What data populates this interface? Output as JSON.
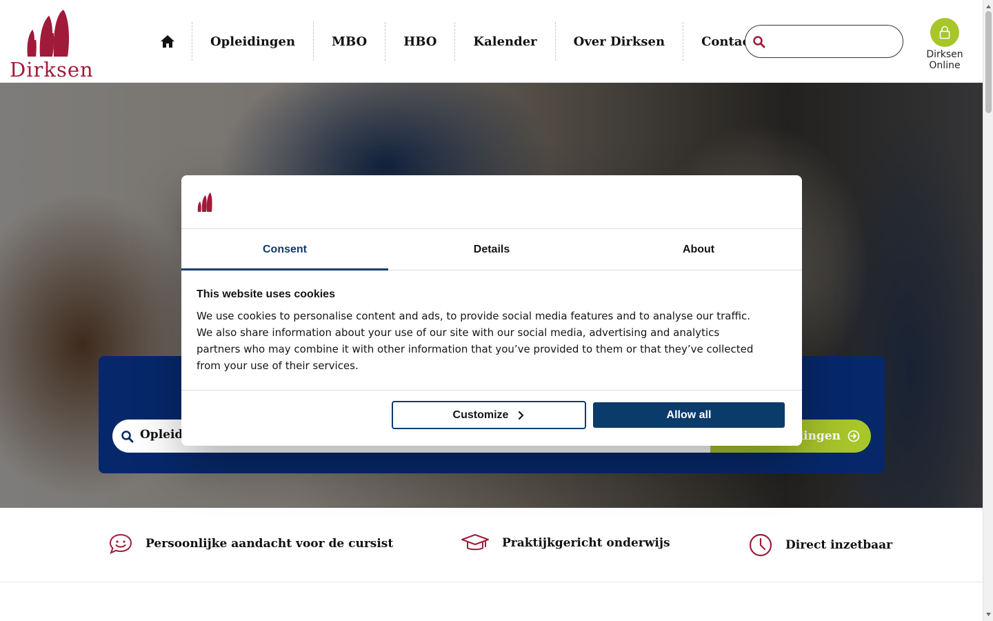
{
  "header": {
    "logo_text": "Dirksen",
    "nav": [
      "Opleidingen",
      "MBO",
      "HBO",
      "Kalender",
      "Over Dirksen",
      "Contact"
    ],
    "search_placeholder": "",
    "online_label": "Dirksen Online"
  },
  "hero": {
    "search_text": "Opleidi",
    "button_label": "dingen"
  },
  "features": [
    {
      "label": "Persoonlijke aandacht voor de cursist",
      "icon": "chat-smile-icon"
    },
    {
      "label": "Praktijkgericht onderwijs",
      "icon": "graduation-cap-icon"
    },
    {
      "label": "Direct inzetbaar",
      "icon": "clock-icon"
    }
  ],
  "cookie_dialog": {
    "tabs": [
      "Consent",
      "Details",
      "About"
    ],
    "active_tab": "Consent",
    "title": "This website uses cookies",
    "body": "We use cookies to personalise content and ads, to provide social media features and to analyse our traffic. We also share information about your use of our site with our social media, advertising and analytics partners who may combine it with other information that you’ve provided to them or that they’ve collected from your use of their services.",
    "customize_label": "Customize",
    "allow_label": "Allow all"
  },
  "colors": {
    "brand_red": "#a01b3a",
    "brand_green": "#a8c52a",
    "navy": "#06286b",
    "dialog_blue": "#0b3b6b"
  }
}
